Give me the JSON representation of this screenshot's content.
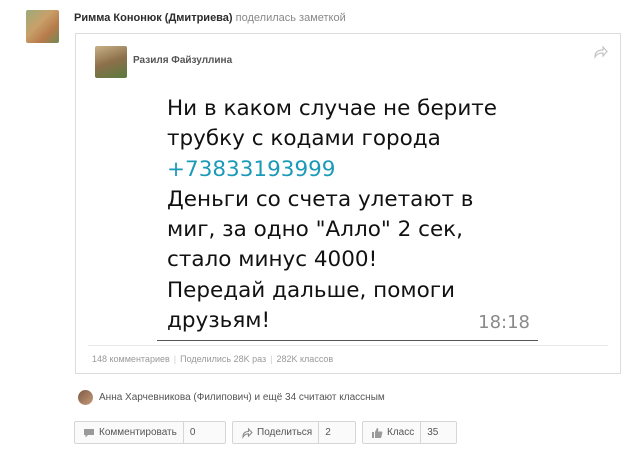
{
  "header": {
    "author_name": "Римма Кононюк (Дмитриева)",
    "action_text": "поделилась заметкой"
  },
  "note": {
    "author_name": "Разиля Файзуллина",
    "message_lines": [
      "Ни в каком случае не берите",
      "трубку с кодами города",
      "+73833193999",
      "Деньги со счета улетают в",
      "миг, за одно \"Алло\" 2 сек,",
      "стало минус 4000!",
      "Передай дальше, помоги",
      "друзьям!"
    ],
    "phone_color": "#1b9ab8",
    "time": "18:18"
  },
  "stats": {
    "comments": "148 комментариев",
    "shares": "Поделились 28K раз",
    "likes": "282K классов"
  },
  "liked_by": "Анна Харчевникова (Филипович) и ещё 34 считают классным",
  "actions": {
    "comment_label": "Комментировать",
    "comment_count": "0",
    "share_label": "Поделиться",
    "share_count": "2",
    "like_label": "Класс",
    "like_count": "35"
  }
}
